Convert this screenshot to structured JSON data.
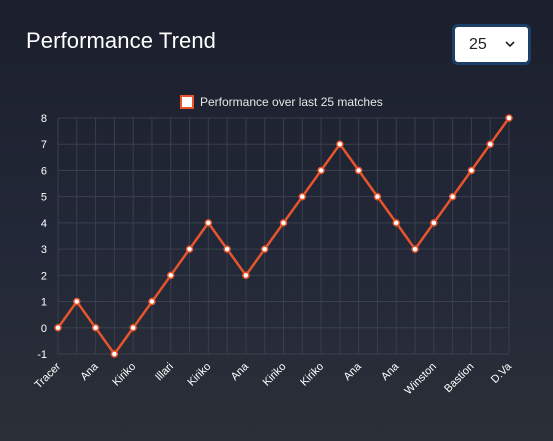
{
  "header": {
    "title": "Performance Trend"
  },
  "match_select": {
    "selected": "25",
    "icon": "chevron-down-icon"
  },
  "colors": {
    "line": "#e8552d",
    "point_fill": "#ffffff",
    "grid": "#3a3f4c"
  },
  "chart_data": {
    "type": "line",
    "title": "",
    "xlabel": "",
    "ylabel": "",
    "ylim": [
      -1,
      8
    ],
    "yticks": [
      -1,
      0,
      1,
      2,
      3,
      4,
      5,
      6,
      7,
      8
    ],
    "tick_labels": [
      "Tracer",
      "Ana",
      "Kiriko",
      "Illari",
      "Kiriko",
      "Ana",
      "Kiriko",
      "Kiriko",
      "Ana",
      "Ana",
      "Winston",
      "Bastion",
      "D.Va"
    ],
    "legend": "top",
    "grid": true,
    "series": [
      {
        "name": "Performance over last 25 matches",
        "values": [
          0,
          1,
          0,
          -1,
          0,
          1,
          2,
          3,
          4,
          3,
          2,
          3,
          4,
          5,
          6,
          7,
          6,
          5,
          4,
          3,
          4,
          5,
          6,
          7,
          8
        ]
      }
    ]
  }
}
